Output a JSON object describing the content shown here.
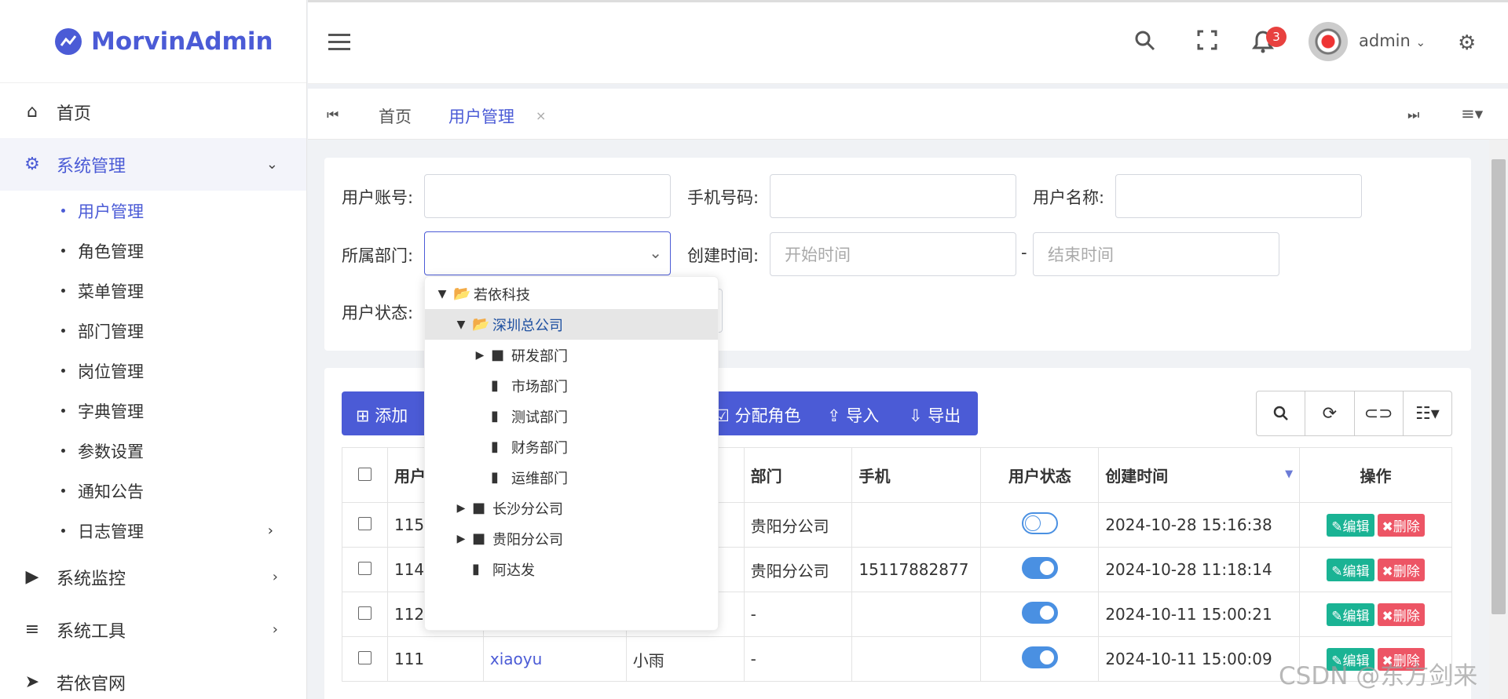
{
  "app": {
    "brand": "MorvinAdmin"
  },
  "sidebar": {
    "items": [
      {
        "label": "首页",
        "icon": "home-icon"
      },
      {
        "label": "系统管理",
        "icon": "gear-icon",
        "active": true
      }
    ],
    "sub_items": [
      {
        "label": "用户管理",
        "active": true
      },
      {
        "label": "角色管理"
      },
      {
        "label": "菜单管理"
      },
      {
        "label": "部门管理"
      },
      {
        "label": "岗位管理"
      },
      {
        "label": "字典管理"
      },
      {
        "label": "参数设置"
      },
      {
        "label": "通知公告"
      },
      {
        "label": "日志管理"
      }
    ],
    "bottom_items": [
      {
        "label": "系统监控",
        "icon": "video-camera-icon"
      },
      {
        "label": "系统工具",
        "icon": "list-icon"
      },
      {
        "label": "若依官网",
        "icon": "send-icon"
      }
    ]
  },
  "header": {
    "notification_count": "3",
    "user_name": "admin"
  },
  "tabs": {
    "home": "首页",
    "active": "用户管理",
    "close": "×"
  },
  "search": {
    "account_label": "用户账号:",
    "phone_label": "手机号码:",
    "username_label": "用户名称:",
    "dept_label": "所属部门:",
    "created_label": "创建时间:",
    "start_placeholder": "开始时间",
    "range_sep": "-",
    "end_placeholder": "结束时间",
    "status_label": "用户状态:"
  },
  "dept_tree": [
    {
      "label": "若依科技"
    },
    {
      "label": "深圳总公司",
      "selected": true
    },
    {
      "label": "研发部门"
    },
    {
      "label": "市场部门"
    },
    {
      "label": "测试部门"
    },
    {
      "label": "财务部门"
    },
    {
      "label": "运维部门"
    },
    {
      "label": "长沙分公司"
    },
    {
      "label": "贵阳分公司"
    },
    {
      "label": "阿达发"
    }
  ],
  "toolbar": {
    "add": "添加",
    "assign_role": "分配角色",
    "import": "导入",
    "export": "导出"
  },
  "table": {
    "headers": [
      "用户",
      "部门",
      "手机",
      "用户状态",
      "创建时间",
      "操作"
    ],
    "rows": [
      {
        "id": "115",
        "login": "",
        "name": "",
        "dept": "贵阳分公司",
        "phone": "",
        "status": "off",
        "created": "2024-10-28 15:16:38"
      },
      {
        "id": "114",
        "login": "",
        "name": "",
        "dept": "贵阳分公司",
        "phone": "15117882877",
        "status": "on",
        "created": "2024-10-28 11:18:14"
      },
      {
        "id": "112",
        "login": "",
        "name": "",
        "dept": "-",
        "phone": "",
        "status": "on",
        "created": "2024-10-11 15:00:21"
      },
      {
        "id": "111",
        "login": "xiaoyu",
        "name": "小雨",
        "dept": "-",
        "phone": "",
        "status": "on",
        "created": "2024-10-11 15:00:09"
      }
    ],
    "edit_label": "编辑",
    "delete_label": "删除"
  },
  "watermark": "CSDN @东方剑来"
}
